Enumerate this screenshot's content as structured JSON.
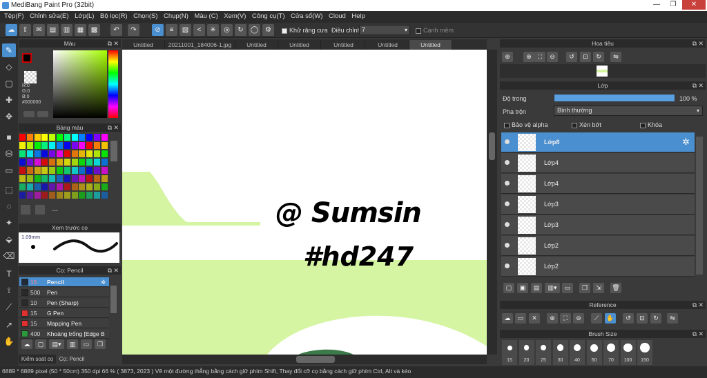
{
  "window": {
    "title": "MediBang Paint Pro (32bit)",
    "min": "—",
    "restore": "❐",
    "close": "✕"
  },
  "menu": [
    "Tệp(F)",
    "Chỉnh sửa(E)",
    "Lớp(L)",
    "Bộ lọc(R)",
    "Chọn(S)",
    "Chụp(N)",
    "Màu (C)",
    "Xem(V)",
    "Công cụ(T)",
    "Cửa sổ(W)",
    "Cloud",
    "Help"
  ],
  "toolbar": {
    "antialias_label": "Khử răng cưa",
    "adjust_label": "Điều chỉnh",
    "adjust_value": "7",
    "edge_label": "Cạnh mềm"
  },
  "tabs": [
    "Untitled",
    "20211001_184006-1.jpg",
    "Untitled",
    "Untitled",
    "Untitled",
    "Untitled",
    "Untitled"
  ],
  "color_panel": {
    "title": "Màu",
    "r": "R:0",
    "g": "G:0",
    "b": "B:0",
    "hex": "#000000"
  },
  "palette_panel": {
    "title": "Bảng màu",
    "footer": "---"
  },
  "preview_panel": {
    "title": "Xem trước cọ",
    "size": "1.09mm"
  },
  "brush_panel": {
    "title": "Cọ: Pencil",
    "brushes": [
      {
        "size": "15",
        "name": "Pencil",
        "color": "#1f2a36"
      },
      {
        "size": "500",
        "name": "Pen",
        "color": "#2a2a2a"
      },
      {
        "size": "10",
        "name": "Pen (Sharp)",
        "color": "#2a2a2a"
      },
      {
        "size": "15",
        "name": "G Pen",
        "color": "#e03030"
      },
      {
        "size": "15",
        "name": "Mapping Pen",
        "color": "#e03030"
      },
      {
        "size": "400",
        "name": "Khoảng trống [Edge B",
        "color": "#2a9a3a"
      }
    ],
    "tab1": "Kiểm soát cọ",
    "tab2": "Cọ: Pencil"
  },
  "navigator": {
    "title": "Hoa tiêu"
  },
  "layer_panel": {
    "title": "Lớp",
    "opacity_label": "Độ trong",
    "opacity_value": "100 %",
    "blend_label": "Pha trộn",
    "blend_value": "Bình thường",
    "protect_alpha": "Bảo vệ alpha",
    "clip": "Xén bớt",
    "lock": "Khóa",
    "layers": [
      "Lớp8",
      "Lớp4",
      "Lớp4",
      "Lớp3",
      "Lớp3",
      "Lớp2",
      "Lớp2"
    ]
  },
  "reference": {
    "title": "Reference"
  },
  "brush_size": {
    "title": "Brush Size",
    "sizes": [
      "15",
      "20",
      "25",
      "30",
      "40",
      "50",
      "70",
      "100",
      "150"
    ]
  },
  "canvas": {
    "line1": "@ Sumsin",
    "line2": "#hd247",
    "bg_green": "#d5f5a3"
  },
  "status": {
    "text": "6889 * 6889 pixel   (50 * 50cm)   350 dpi   66 %   ( 3873, 2023 )   Vẽ một đường thẳng bằng cách giữ phím Shift, Thay đổi cỡ cọ bằng cách giữ phím Ctrl, Alt và kéo"
  }
}
